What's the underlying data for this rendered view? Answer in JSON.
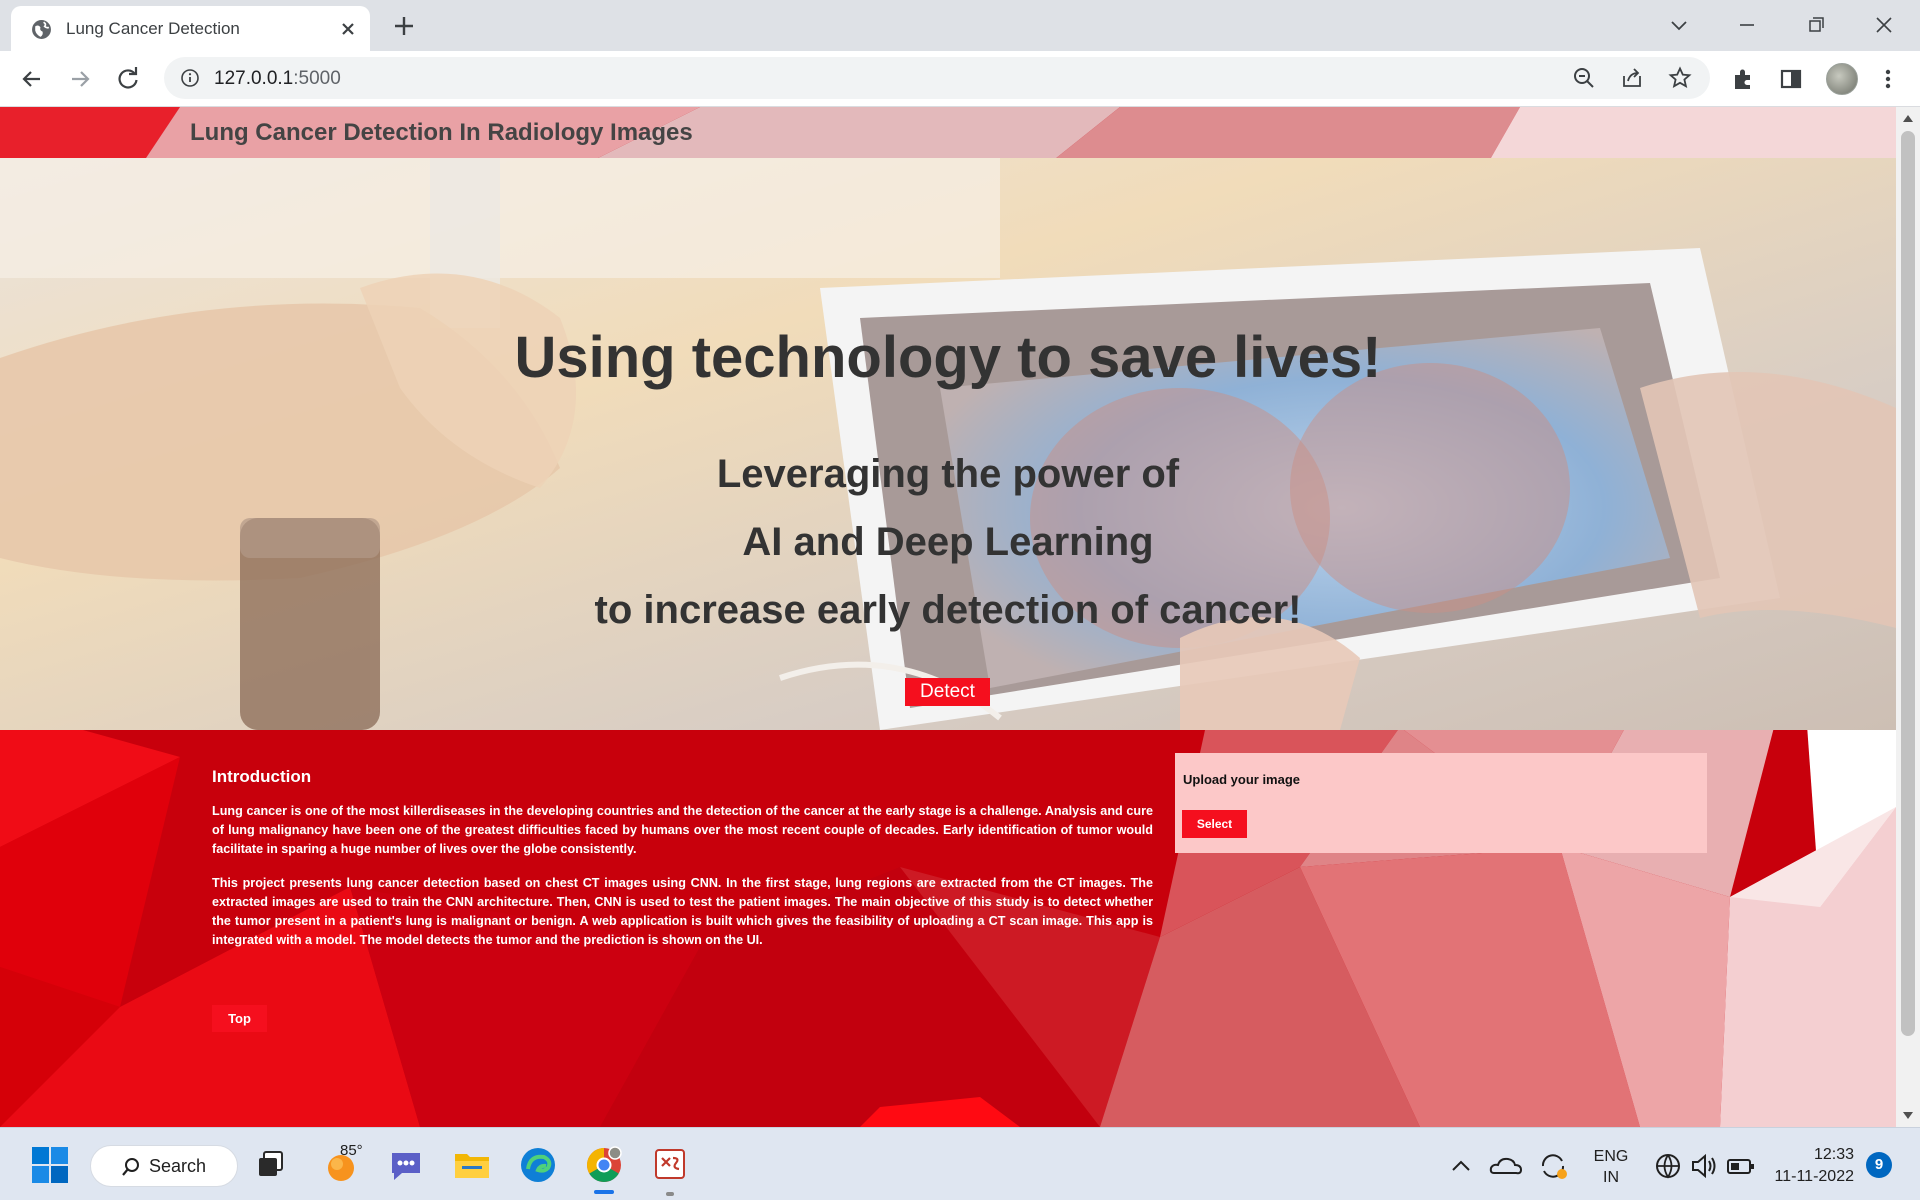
{
  "browser": {
    "tab_title": "Lung Cancer Detection",
    "url_host": "127.0.0.1",
    "url_port": ":5000"
  },
  "site": {
    "title": "Lung Cancer Detection In Radiology Images"
  },
  "hero": {
    "heading": "Using technology to save lives!",
    "line1": "Leveraging the power of",
    "line2": "AI and Deep Learning",
    "line3": "to increase early detection of cancer!",
    "detect_label": "Detect"
  },
  "intro": {
    "title": "Introduction",
    "para1": "Lung cancer is one of the most killerdiseases in the developing countries and the detection of the cancer at the early stage is a challenge. Analysis and cure of lung malignancy have been one of the greatest difficulties faced by humans over the most recent couple of decades. Early identification of tumor would facilitate in sparing a huge number of lives over the globe consistently.",
    "para2": "This project presents lung cancer detection based on chest CT images using CNN. In the first stage, lung regions are extracted from the CT images. The extracted images are used to train the CNN architecture. Then, CNN is used to test the patient images. The main objective of this study is to detect whether the tumor present in a patient's lung is malignant or benign. A web application is built which gives the feasibility of uploading a CT scan image. This app is integrated with a model. The model detects the tumor and the prediction is shown on the UI.",
    "top_label": "Top"
  },
  "upload": {
    "label": "Upload your image",
    "select_label": "Select"
  },
  "taskbar": {
    "search_label": "Search",
    "weather_temp": "85°",
    "lang_line1": "ENG",
    "lang_line2": "IN",
    "time": "12:33",
    "date": "11-11-2022",
    "notification_count": "9"
  },
  "colors": {
    "accent_red": "#f50f1e",
    "upload_panel": "#fcc8c8",
    "text_dark": "#333333"
  }
}
